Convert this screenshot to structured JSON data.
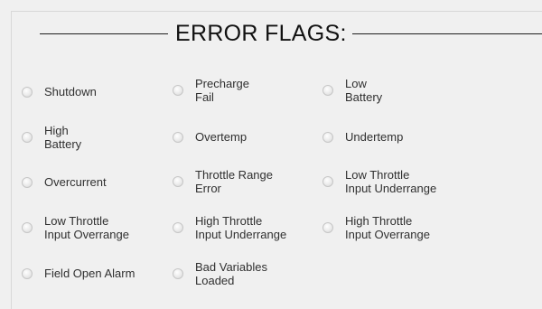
{
  "panel": {
    "title": "ERROR FLAGS:"
  },
  "flags": [
    {
      "id": "shutdown",
      "label": "Shutdown",
      "selected": false
    },
    {
      "id": "precharge-fail",
      "label": "Precharge\nFail",
      "selected": false
    },
    {
      "id": "low-battery",
      "label": "Low\nBattery",
      "selected": false
    },
    {
      "id": "high-battery",
      "label": "High\nBattery",
      "selected": false
    },
    {
      "id": "overtemp",
      "label": "Overtemp",
      "selected": false
    },
    {
      "id": "undertemp",
      "label": "Undertemp",
      "selected": false
    },
    {
      "id": "overcurrent",
      "label": "Overcurrent",
      "selected": false
    },
    {
      "id": "throttle-range-error",
      "label": "Throttle Range\nError",
      "selected": false
    },
    {
      "id": "low-throttle-input-underrange",
      "label": "Low Throttle\nInput Underrange",
      "selected": false
    },
    {
      "id": "low-throttle-input-overrange",
      "label": "Low Throttle\nInput Overrange",
      "selected": false
    },
    {
      "id": "high-throttle-input-underrange",
      "label": "High Throttle\nInput Underrange",
      "selected": false
    },
    {
      "id": "high-throttle-input-overrange",
      "label": "High Throttle\nInput Overrange",
      "selected": false
    },
    {
      "id": "field-open-alarm",
      "label": "Field Open Alarm",
      "selected": false
    },
    {
      "id": "bad-variables-loaded",
      "label": "Bad Variables\nLoaded",
      "selected": false
    }
  ]
}
